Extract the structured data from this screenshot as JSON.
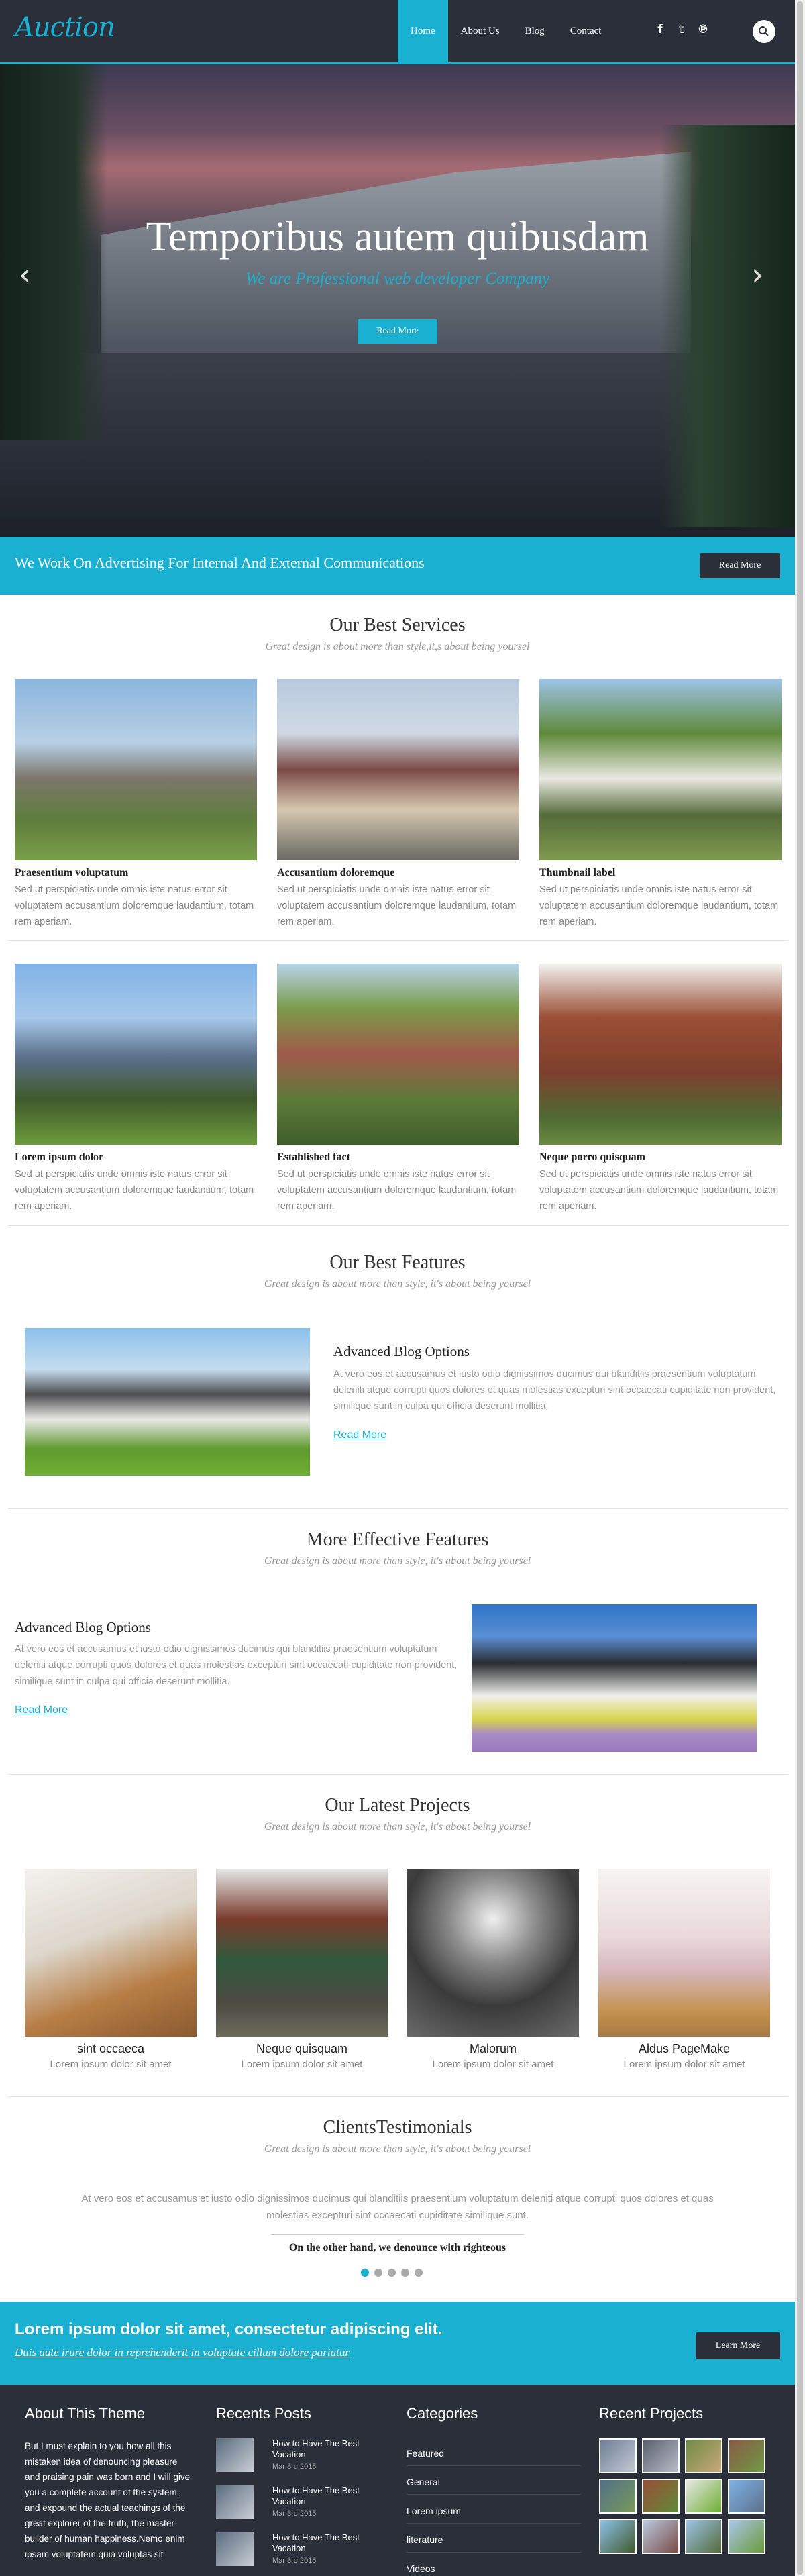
{
  "header": {
    "logo": "Auction",
    "nav": [
      "Home",
      "About Us",
      "Blog",
      "Contact"
    ],
    "social_icons": [
      "facebook-icon",
      "twitter-icon",
      "pinterest-icon"
    ],
    "social_glyphs": [
      "f",
      "𝕥",
      "℗"
    ]
  },
  "hero": {
    "title": "Temporibus autem quibusdam",
    "subtitle": "We are Professional web developer Company",
    "button": "Read More",
    "prev": "‹",
    "next": "›"
  },
  "banner": {
    "text": "We Work On Advertising For Internal And External Communications",
    "button": "Read More"
  },
  "services": {
    "title": "Our Best Services",
    "subtitle": "Great design is about more than style,it,s about being yoursel",
    "items": [
      {
        "name": "Praesentium voluptatum",
        "desc": "Sed ut perspiciatis unde omnis iste natus error sit voluptatem accusantium doloremque laudantium, totam rem aperiam."
      },
      {
        "name": "Accusantium doloremque",
        "desc": "Sed ut perspiciatis unde omnis iste natus error sit voluptatem accusantium doloremque laudantium, totam rem aperiam."
      },
      {
        "name": "Thumbnail label",
        "desc": "Sed ut perspiciatis unde omnis iste natus error sit voluptatem accusantium doloremque laudantium, totam rem aperiam."
      },
      {
        "name": "Lorem ipsum dolor",
        "desc": "Sed ut perspiciatis unde omnis iste natus error sit voluptatem accusantium doloremque laudantium, totam rem aperiam."
      },
      {
        "name": "Established fact",
        "desc": "Sed ut perspiciatis unde omnis iste natus error sit voluptatem accusantium doloremque laudantium, totam rem aperiam."
      },
      {
        "name": "Neque porro quisquam",
        "desc": "Sed ut perspiciatis unde omnis iste natus error sit voluptatem accusantium doloremque laudantium, totam rem aperiam."
      }
    ]
  },
  "features": {
    "title": "Our Best Features",
    "subtitle": "Great design is about more than style, it's about being yoursel",
    "item_title": "Advanced Blog Options",
    "item_desc": "At vero eos et accusamus et iusto odio dignissimos ducimus qui blanditiis praesentium voluptatum deleniti atque corrupti quos dolores et quas molestias excepturi sint occaecati cupiditate non provident, similique sunt in culpa qui officia deserunt mollitia.",
    "link": "Read More"
  },
  "more_features": {
    "title": "More Effective Features",
    "subtitle": "Great design is about more than style, it's about being yoursel",
    "item_title": "Advanced Blog Options",
    "item_desc": "At vero eos et accusamus et iusto odio dignissimos ducimus qui blanditiis praesentium voluptatum deleniti atque corrupti quos dolores et quas molestias excepturi sint occaecati cupiditate non provident, similique sunt in culpa qui officia deserunt mollitia.",
    "link": "Read More"
  },
  "projects": {
    "title": "Our Latest Projects",
    "subtitle": "Great design is about more than style, it's about being yoursel",
    "items": [
      {
        "name": "sint occaeca",
        "desc": "Lorem ipsum dolor sit amet"
      },
      {
        "name": "Neque quisquam",
        "desc": "Lorem ipsum dolor sit amet"
      },
      {
        "name": "Malorum",
        "desc": "Lorem ipsum dolor sit amet"
      },
      {
        "name": "Aldus PageMake",
        "desc": "Lorem ipsum dolor sit amet"
      }
    ]
  },
  "testimonials": {
    "title": "ClientsTestimonials",
    "subtitle": "Great design is about more than style, it's about being yoursel",
    "text": "At vero eos et accusamus et iusto odio dignissimos ducimus qui blanditiis praesentium voluptatum deleniti atque corrupti quos dolores et quas molestias excepturi sint occaecati cupiditate similique sunt.",
    "author": "On the other hand, we denounce with righteous"
  },
  "cta": {
    "title": "Lorem ipsum dolor sit amet, consectetur adipiscing elit.",
    "subtitle": "Duis aute irure dolor in reprehenderit in voluptate cillum dolore pariatur",
    "button": "Learn More"
  },
  "footer": {
    "about_title": "About This Theme",
    "about_text": "But I must explain to you how all this mistaken idea of denouncing pleasure and praising pain was born and I will give you a complete account of the system, and expound the actual teachings of the great explorer of the truth, the master-builder of human happiness.Nemo enim ipsam voluptatem quia voluptas sit",
    "posts_title": "Recents Posts",
    "posts": [
      {
        "title": "How to Have The Best Vacation",
        "date": "Mar 3rd,2015"
      },
      {
        "title": "How to Have The Best Vacation",
        "date": "Mar 3rd,2015"
      },
      {
        "title": "How to Have The Best Vacation",
        "date": "Mar 3rd,2015"
      }
    ],
    "categories_title": "Categories",
    "categories": [
      "Featured",
      "General",
      "Lorem ipsum",
      "literature",
      "Videos"
    ],
    "projects_title": "Recent Projects"
  },
  "colors": {
    "accent": "#1ab0d2",
    "dark": "#2b2f3a"
  }
}
